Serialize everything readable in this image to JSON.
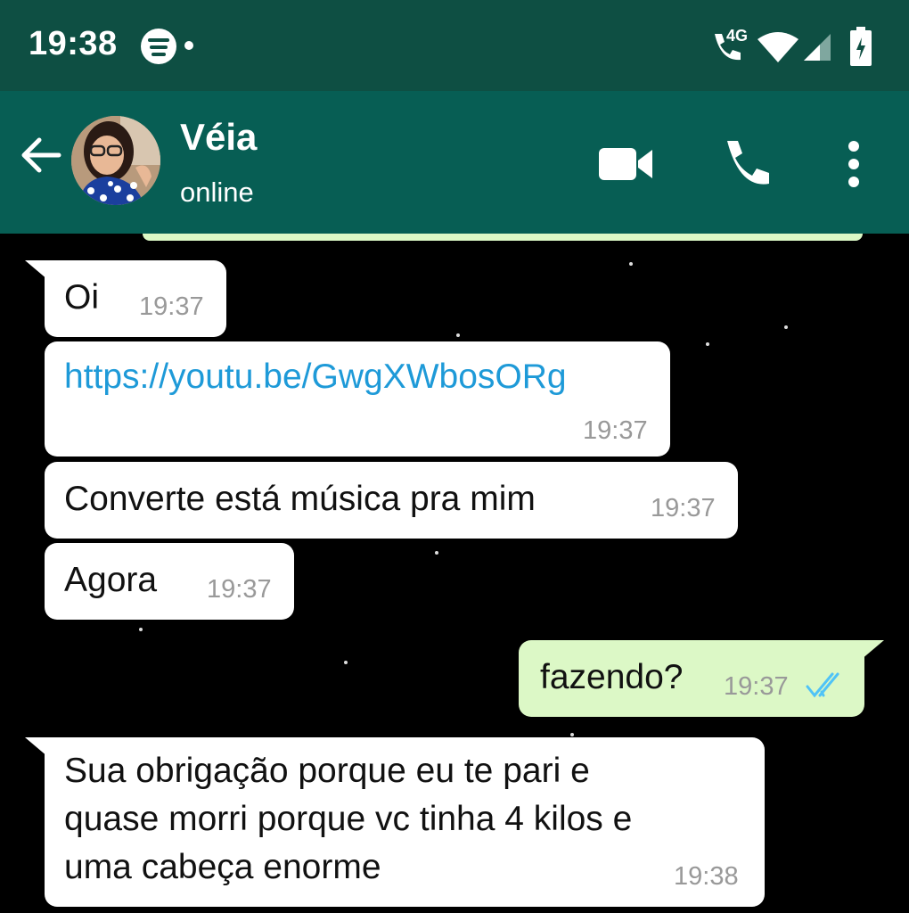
{
  "status_bar": {
    "time": "19:38",
    "network": "4G",
    "icons": [
      "spotify-icon",
      "notification-dot-icon",
      "wifi-calling-icon",
      "wifi-icon",
      "signal-icon",
      "battery-charging-icon"
    ]
  },
  "header": {
    "contact_name": "Véia",
    "contact_status": "online",
    "icons": [
      "back-arrow-icon",
      "avatar",
      "video-call-icon",
      "voice-call-icon",
      "more-options-icon"
    ]
  },
  "messages": [
    {
      "direction": "incoming",
      "text": "Oi",
      "time": "19:37"
    },
    {
      "direction": "incoming",
      "text": "https://youtu.be/GwgXWbosORg",
      "time": "19:37",
      "is_link": true
    },
    {
      "direction": "incoming",
      "text": "Converte está música pra mim",
      "time": "19:37"
    },
    {
      "direction": "incoming",
      "text": "Agora",
      "time": "19:37"
    },
    {
      "direction": "outgoing",
      "text": "fazendo?",
      "time": "19:37",
      "read": true
    },
    {
      "direction": "incoming",
      "lines": [
        "Sua obrigação porque eu te pari e",
        "quase morri porque vc tinha 4 kilos e",
        "uma cabeça enorme"
      ],
      "time": "19:38"
    }
  ],
  "colors": {
    "status_bar": "#0e4f43",
    "header": "#075e54",
    "chat_background": "#000000",
    "incoming_bubble": "#ffffff",
    "outgoing_bubble": "#dcf8c6",
    "link": "#1e9ad8",
    "read_ticks": "#4fc3f7"
  }
}
